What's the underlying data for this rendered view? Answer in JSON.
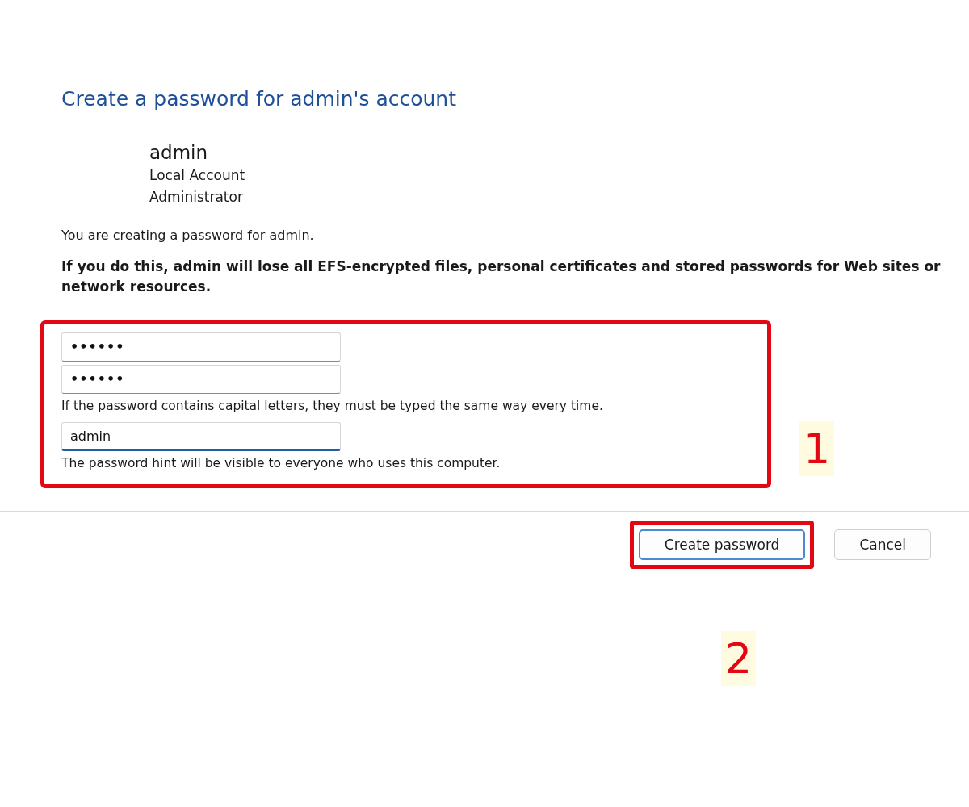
{
  "heading": "Create a password for admin's account",
  "account": {
    "name": "admin",
    "type": "Local Account",
    "role": "Administrator"
  },
  "intro": "You are creating a password for admin.",
  "warning": "If you do this, admin will lose all EFS-encrypted files, personal certificates and stored passwords for Web sites or network resources.",
  "fields": [
    {
      "kind": "password",
      "value": "••••••",
      "focused": false
    },
    {
      "kind": "password",
      "value": "••••••",
      "focused": false
    },
    {
      "kind": "note",
      "text": "If the password contains capital letters, they must be typed the same way every time."
    },
    {
      "kind": "hint",
      "value": "admin",
      "focused": true
    },
    {
      "kind": "note",
      "text": "The password hint will be visible to everyone who uses this computer."
    }
  ],
  "buttons": [
    {
      "label": "Create password",
      "default": true,
      "highlighted": true
    },
    {
      "label": "Cancel",
      "default": false,
      "highlighted": false
    }
  ],
  "annotations": [
    {
      "number": "1",
      "kind": "fields"
    },
    {
      "number": "2",
      "kind": "button"
    }
  ]
}
